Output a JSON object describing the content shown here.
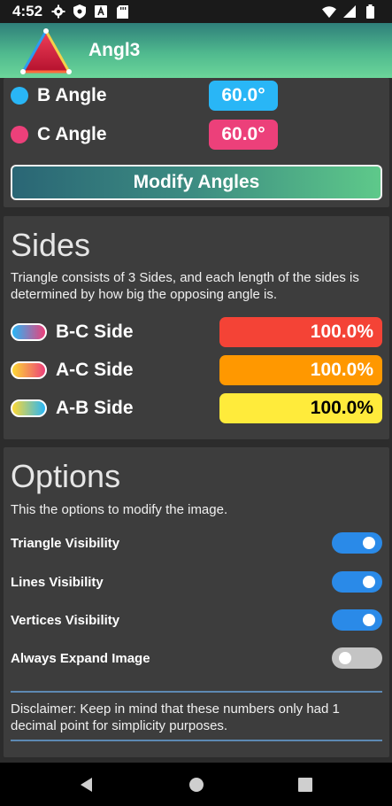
{
  "status_bar": {
    "time": "4:52",
    "icons": [
      "gear-icon",
      "shield-icon",
      "text-badge-icon",
      "sd-card-icon",
      "wifi-icon",
      "signal-icon",
      "battery-icon"
    ]
  },
  "app_bar": {
    "title": "Angl3",
    "logo": "triangle-logo-icon"
  },
  "angles": {
    "items": [
      {
        "label": "B Angle",
        "value": "60.0°",
        "color": "#29b6f6"
      },
      {
        "label": "C Angle",
        "value": "60.0°",
        "color": "#ec407a"
      }
    ],
    "modify_button": "Modify Angles"
  },
  "sides": {
    "title": "Sides",
    "description": "Triangle consists of 3 Sides, and each length of the sides is determined by how big the opposing angle is.",
    "items": [
      {
        "label": "B-C Side",
        "value": "100.0%",
        "color": "#f44336",
        "text_color": "#ffffff",
        "pill_gradient": [
          "#29b6f6",
          "#ec407a"
        ]
      },
      {
        "label": "A-C Side",
        "value": "100.0%",
        "color": "#ff9800",
        "text_color": "#ffffff",
        "pill_gradient": [
          "#fdd835",
          "#ec407a"
        ]
      },
      {
        "label": "A-B Side",
        "value": "100.0%",
        "color": "#ffeb3b",
        "text_color": "#000000",
        "pill_gradient": [
          "#fdd835",
          "#29b6f6"
        ]
      }
    ]
  },
  "options": {
    "title": "Options",
    "description": "This the options to modify the image.",
    "toggles": [
      {
        "label": "Triangle Visibility",
        "on": true
      },
      {
        "label": "Lines Visibility",
        "on": true
      },
      {
        "label": "Vertices Visibility",
        "on": true
      },
      {
        "label": "Always Expand Image",
        "on": false
      }
    ],
    "disclaimer": "Disclaimer: Keep in mind that these numbers only had 1 decimal point for simplicity purposes."
  },
  "nav_bar": {
    "buttons": [
      "back-icon",
      "home-icon",
      "recents-icon"
    ]
  },
  "colors": {
    "accent_blue": "#2a8ae8",
    "card_bg": "#3d3d3d",
    "page_bg": "#2c2c2c"
  }
}
